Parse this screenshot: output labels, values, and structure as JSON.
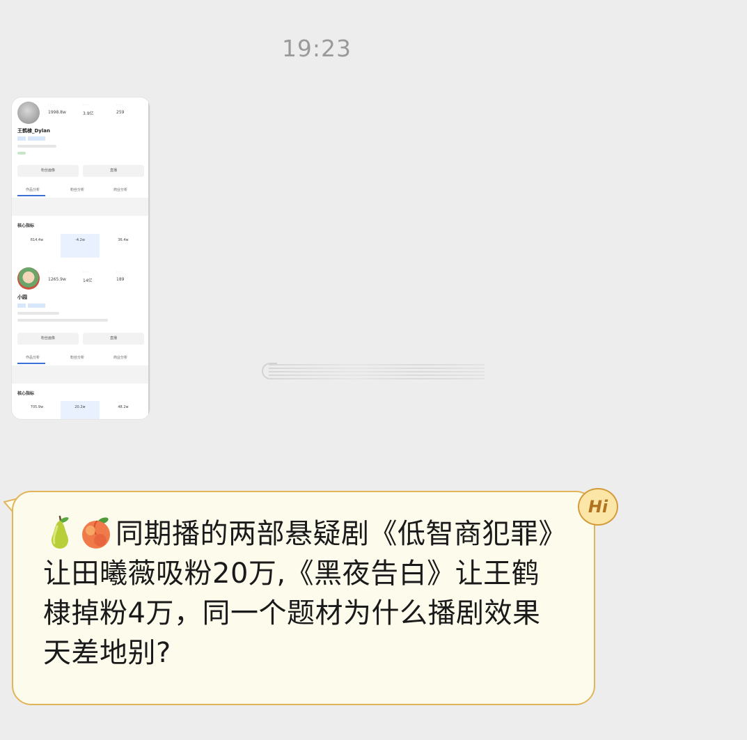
{
  "chat": {
    "timestamp": "19:23",
    "image_message": {
      "profile_1": {
        "name": "王鹤棣_Dylan",
        "stats": [
          "1998.8w",
          "3.9亿",
          "259"
        ],
        "buttons": [
          "粉丝画像",
          "直播"
        ],
        "tabs": [
          "作品分析",
          "粉丝分析",
          "商业分析"
        ],
        "section_title": "核心指标",
        "metrics": [
          "814.4w",
          "-4.2w",
          "36.4w"
        ]
      },
      "profile_2": {
        "name": "小园",
        "stats": [
          "1265.9w",
          "14亿",
          "189"
        ],
        "buttons": [
          "粉丝画像",
          "直播"
        ],
        "tabs": [
          "作品分析",
          "粉丝分析",
          "商业分析"
        ],
        "section_title": "核心指标",
        "metrics": [
          "705.9w",
          "20.2w",
          "48.2w"
        ]
      }
    },
    "text_message": {
      "emoji_1": "pear-emoji",
      "emoji_2": "peach-emoji",
      "text": "同期播的两部悬疑剧《低智商犯罪》让田曦薇吸粉20万,《黑夜告白》让王鹤棣掉粉4万，同一个题材为什么播剧效果天差地别?",
      "badge_label": "Hi"
    },
    "colors": {
      "background": "#ededed",
      "bubble_fill": "#fdfbec",
      "bubble_border": "#e2b45a",
      "timestamp": "#9a9a9a"
    }
  }
}
